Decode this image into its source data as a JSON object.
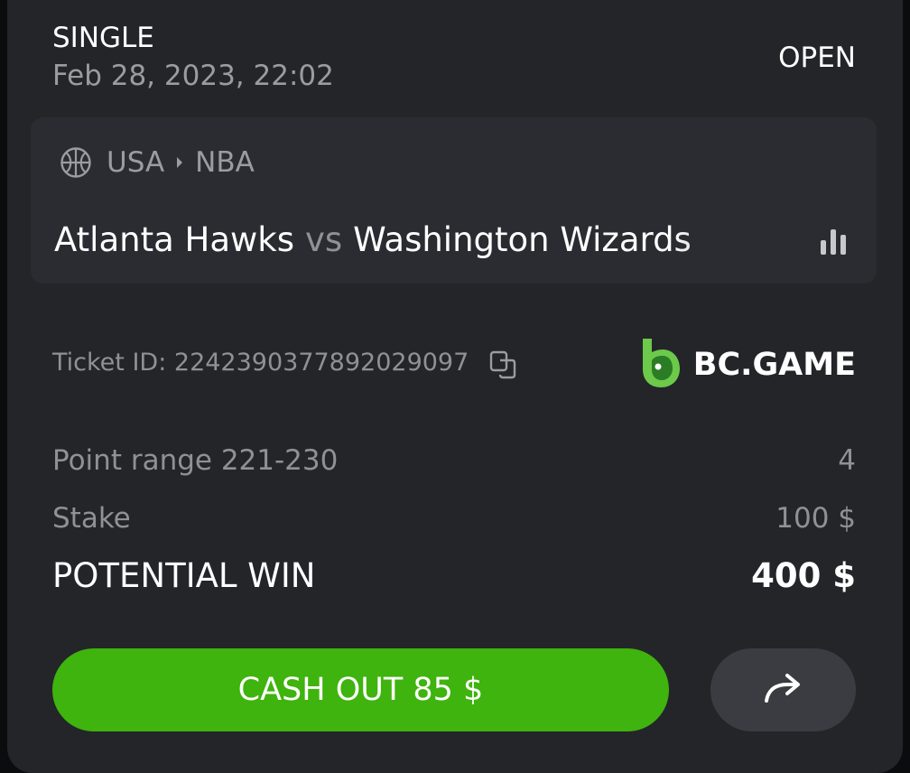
{
  "bet": {
    "type": "SINGLE",
    "date": "Feb 28, 2023, 22:02",
    "status": "OPEN"
  },
  "event": {
    "country": "USA",
    "league": "NBA",
    "home_team": "Atlanta Hawks",
    "vs": "vs",
    "away_team": "Washington Wizards",
    "sport_icon": "basketball-icon",
    "stats_icon": "bar-chart-icon"
  },
  "ticket": {
    "label": "Ticket ID: 2242390377892029097",
    "copy_icon": "copy-icon"
  },
  "brand": {
    "name": "BC.GAME",
    "logo_color": "#6cc94a"
  },
  "summary": {
    "selection_label": "Point range 221-230",
    "odds": "4",
    "stake_label": "Stake",
    "stake_value": "100 $",
    "win_label": "POTENTIAL WIN",
    "win_value": "400 $"
  },
  "actions": {
    "cashout_label": "CASH OUT 85 $",
    "cashout_color": "#3fb30e",
    "share_icon": "share-arrow-icon"
  }
}
